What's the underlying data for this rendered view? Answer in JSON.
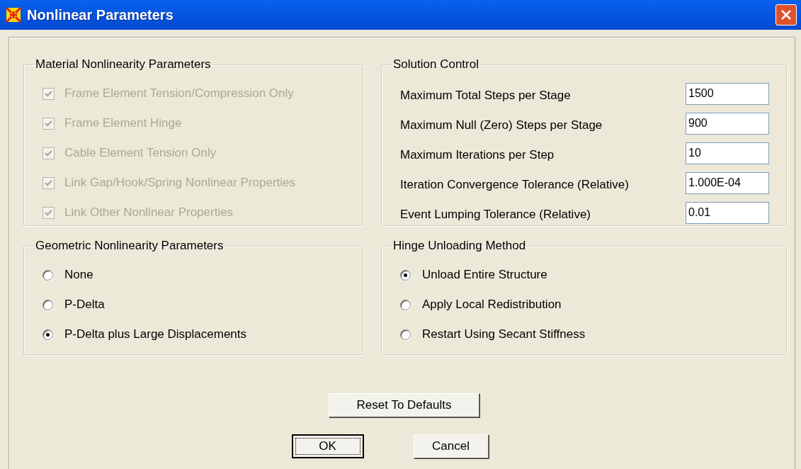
{
  "window": {
    "title": "Nonlinear Parameters"
  },
  "material": {
    "title": "Material Nonlinearity Parameters",
    "items": [
      {
        "label": "Frame Element Tension/Compression Only",
        "checked": true,
        "disabled": true
      },
      {
        "label": "Frame Element Hinge",
        "checked": true,
        "disabled": true
      },
      {
        "label": "Cable Element Tension Only",
        "checked": true,
        "disabled": true
      },
      {
        "label": "Link Gap/Hook/Spring Nonlinear Properties",
        "checked": true,
        "disabled": true
      },
      {
        "label": "Link Other Nonlinear Properties",
        "checked": true,
        "disabled": true
      }
    ]
  },
  "solution": {
    "title": "Solution Control",
    "fields": [
      {
        "label": "Maximum Total Steps per Stage",
        "value": "1500"
      },
      {
        "label": "Maximum Null (Zero) Steps per Stage",
        "value": "900"
      },
      {
        "label": "Maximum Iterations per Step",
        "value": "10"
      },
      {
        "label": "Iteration Convergence Tolerance (Relative)",
        "value": "1.000E-04"
      },
      {
        "label": "Event Lumping Tolerance (Relative)",
        "value": "0.01"
      }
    ]
  },
  "geometric": {
    "title": "Geometric Nonlinearity Parameters",
    "options": [
      {
        "label": "None",
        "selected": false
      },
      {
        "label": "P-Delta",
        "selected": false
      },
      {
        "label": "P-Delta plus Large Displacements",
        "selected": true
      }
    ]
  },
  "hinge": {
    "title": "Hinge Unloading Method",
    "options": [
      {
        "label": "Unload Entire Structure",
        "selected": true
      },
      {
        "label": "Apply Local Redistribution",
        "selected": false
      },
      {
        "label": "Restart Using Secant Stiffness",
        "selected": false
      }
    ]
  },
  "buttons": [
    {
      "label": "Reset To Defaults",
      "kind": "reset"
    },
    {
      "label": "OK",
      "kind": "default"
    },
    {
      "label": "Cancel",
      "kind": "normal"
    }
  ]
}
